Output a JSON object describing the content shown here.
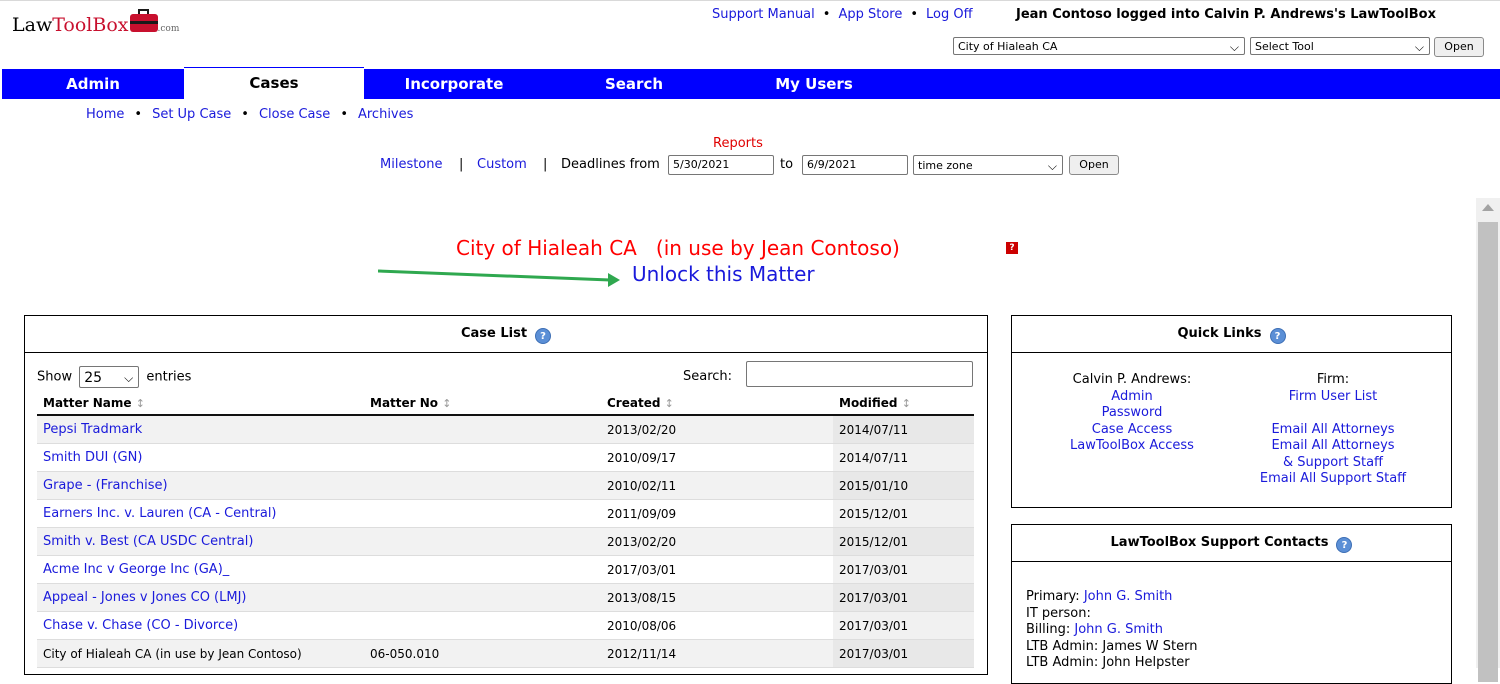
{
  "logo": {
    "law": "Law",
    "toolbox": "ToolBox",
    "com": ".com"
  },
  "header": {
    "links": [
      "Support Manual",
      "App Store",
      "Log Off"
    ],
    "logged_in": "Jean Contoso logged into Calvin P. Andrews's LawToolBox",
    "matter_select": "City of Hialeah CA",
    "tool_select": "Select Tool",
    "open_label": "Open"
  },
  "nav": {
    "items": [
      "Admin",
      "Cases",
      "Incorporate",
      "Search",
      "My Users"
    ],
    "active": "Cases",
    "accent": "#0000ff"
  },
  "subnav": [
    "Home",
    "Set Up Case",
    "Close Case",
    "Archives"
  ],
  "reports": {
    "title": "Reports",
    "milestone": "Milestone",
    "custom": "Custom",
    "deadlines_from": "Deadlines from",
    "from_date": "5/30/2021",
    "to_label": "to",
    "to_date": "6/9/2021",
    "timezone": "time zone",
    "open_label": "Open"
  },
  "matter": {
    "title": "City of Hialeah CA   (in use by Jean Contoso)",
    "help_glyph": "?",
    "unlock": "Unlock this Matter"
  },
  "case_list": {
    "title": "Case List",
    "show_label": "Show",
    "entries_value": "25",
    "entries_label": "entries",
    "search_label": "Search:",
    "columns": [
      "Matter Name",
      "Matter No",
      "Created",
      "Modified"
    ],
    "rows": [
      {
        "name": "Pepsi Tradmark",
        "no": "",
        "created": "2013/02/20",
        "modified": "2014/07/11",
        "link": true
      },
      {
        "name": "Smith DUI (GN)",
        "no": "",
        "created": "2010/09/17",
        "modified": "2014/07/11",
        "link": true
      },
      {
        "name": "Grape - (Franchise)",
        "no": "",
        "created": "2010/02/11",
        "modified": "2015/01/10",
        "link": true
      },
      {
        "name": "Earners Inc. v. Lauren (CA - Central)",
        "no": "",
        "created": "2011/09/09",
        "modified": "2015/12/01",
        "link": true
      },
      {
        "name": "Smith v. Best (CA USDC Central)",
        "no": "",
        "created": "2013/02/20",
        "modified": "2015/12/01",
        "link": true
      },
      {
        "name": "Acme Inc v George Inc (GA)_",
        "no": "",
        "created": "2017/03/01",
        "modified": "2017/03/01",
        "link": true
      },
      {
        "name": "Appeal - Jones v Jones CO  (LMJ)",
        "no": "",
        "created": "2013/08/15",
        "modified": "2017/03/01",
        "link": true
      },
      {
        "name": "Chase v. Chase (CO - Divorce)",
        "no": "",
        "created": "2010/08/06",
        "modified": "2017/03/01",
        "link": true
      },
      {
        "name": "City of Hialeah CA   (in use by Jean Contoso)",
        "no": "06-050.010",
        "created": "2012/11/14",
        "modified": "2017/03/01",
        "link": false
      }
    ]
  },
  "quick_links": {
    "title": "Quick Links",
    "left_heading": "Calvin P. Andrews:",
    "left_links": [
      "Admin",
      "Password",
      "Case Access",
      "LawToolBox Access"
    ],
    "right_heading": "Firm:",
    "right_links": [
      "Firm User List",
      "Email All Attorneys",
      "Email All Attorneys & Support Staff",
      "Email All Support Staff"
    ]
  },
  "support": {
    "title": "LawToolBox Support Contacts",
    "primary_label": "Primary:",
    "primary_name": "John G. Smith",
    "it_label": "IT person:",
    "billing_label": "Billing:",
    "billing_name": "John G. Smith",
    "admin1": "LTB Admin: James W Stern",
    "admin2": "LTB Admin: John Helpster"
  }
}
